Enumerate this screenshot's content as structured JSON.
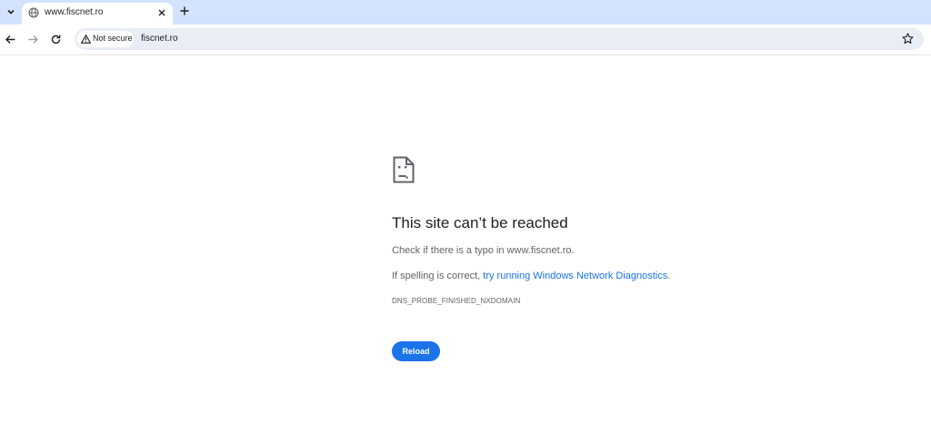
{
  "browser": {
    "tab": {
      "title": "www.fiscnet.ro",
      "favicon": "globe-icon"
    },
    "toolbar": {
      "security_label": "Not secure",
      "url": "fiscnet.ro"
    }
  },
  "error_page": {
    "title": "This site can’t be reached",
    "check_text": "Check if there is a typo in www.fiscnet.ro.",
    "spelling_prefix": "If spelling is correct, ",
    "diagnostics_link": "try running Windows Network Diagnostics",
    "spelling_suffix": ".",
    "error_code": "DNS_PROBE_FINISHED_NXDOMAIN",
    "reload_label": "Reload",
    "icon": "sad-document-icon"
  },
  "colors": {
    "tabstrip": "#d3e3fd",
    "omnibox": "#e9eef6",
    "accent": "#1a73e8"
  }
}
